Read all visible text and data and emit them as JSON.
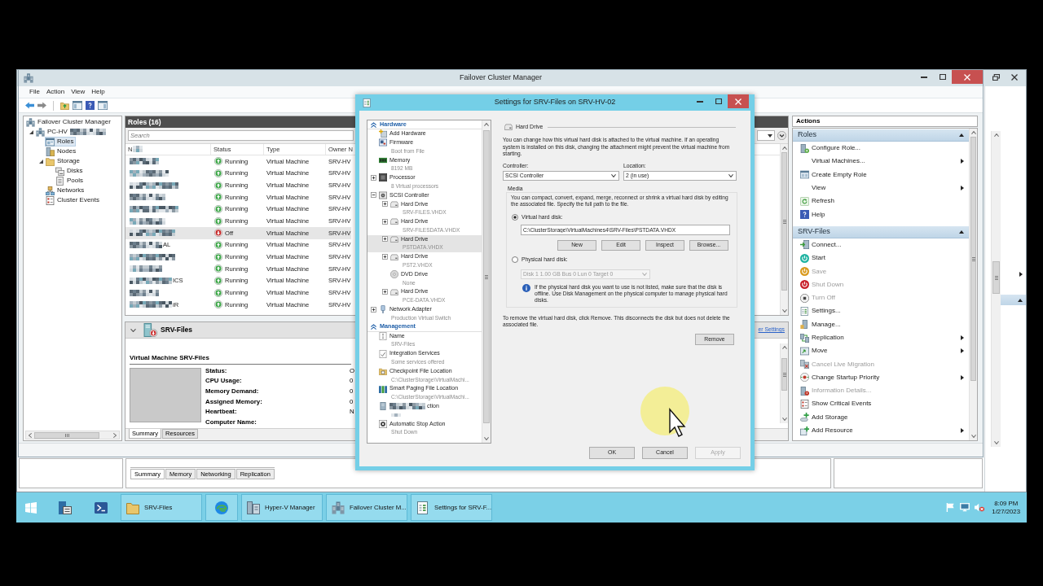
{
  "fcm_window": {
    "title": "Failover Cluster Manager",
    "menu": [
      "File",
      "Action",
      "View",
      "Help"
    ],
    "tree": [
      {
        "label": "Failover Cluster Manager",
        "kind": "cluster-manager",
        "selected": false,
        "children": [
          {
            "label": "PC-HV",
            "kind": "cluster",
            "redacted": true,
            "expanded": true,
            "selected": false,
            "children": [
              {
                "label": "Roles",
                "kind": "roles",
                "selected": true
              },
              {
                "label": "Nodes",
                "kind": "nodes",
                "selected": false
              },
              {
                "label": "Storage",
                "kind": "storage",
                "expanded": true,
                "selected": false,
                "children": [
                  {
                    "label": "Disks",
                    "kind": "disks",
                    "selected": false
                  },
                  {
                    "label": "Pools",
                    "kind": "pools",
                    "selected": false
                  }
                ]
              },
              {
                "label": "Networks",
                "kind": "networks",
                "selected": false
              },
              {
                "label": "Cluster Events",
                "kind": "events",
                "selected": false
              }
            ]
          }
        ]
      }
    ],
    "roles": {
      "title": "Roles (16)",
      "search": {
        "placeholder": "Search"
      },
      "columns": [
        {
          "label": "N",
          "redacted": true
        },
        {
          "label": "Status",
          "redacted": false
        },
        {
          "label": "Type",
          "redacted": false
        },
        {
          "label": "Owner N",
          "redacted": false
        }
      ],
      "rows": [
        {
          "kind": "running",
          "status": "Running",
          "type": "Virtual Machine",
          "owner": "SRV-HV",
          "selected": false
        },
        {
          "kind": "running",
          "status": "Running",
          "type": "Virtual Machine",
          "owner": "SRV-HV",
          "selected": false
        },
        {
          "kind": "running",
          "status": "Running",
          "type": "Virtual Machine",
          "owner": "SRV-HV",
          "selected": false
        },
        {
          "kind": "running",
          "status": "Running",
          "type": "Virtual Machine",
          "owner": "SRV-HV",
          "selected": false
        },
        {
          "kind": "running",
          "status": "Running",
          "type": "Virtual Machine",
          "owner": "SRV-HV",
          "selected": false
        },
        {
          "kind": "running",
          "status": "Running",
          "type": "Virtual Machine",
          "owner": "SRV-HV",
          "selected": false
        },
        {
          "kind": "off",
          "status": "Off",
          "type": "Virtual Machine",
          "owner": "SRV-HV",
          "selected": true
        },
        {
          "name": "AL",
          "kind": "running",
          "status": "Running",
          "type": "Virtual Machine",
          "owner": "SRV-HV",
          "selected": false
        },
        {
          "kind": "running",
          "status": "Running",
          "type": "Virtual Machine",
          "owner": "SRV-HV",
          "selected": false
        },
        {
          "kind": "running",
          "status": "Running",
          "type": "Virtual Machine",
          "owner": "SRV-HV",
          "selected": false
        },
        {
          "name": "ICS",
          "kind": "running",
          "status": "Running",
          "type": "Virtual Machine",
          "owner": "SRV-HV",
          "selected": false
        },
        {
          "kind": "running",
          "status": "Running",
          "type": "Virtual Machine",
          "owner": "SRV-HV",
          "selected": false
        },
        {
          "name": "iR",
          "kind": "running",
          "status": "Running",
          "type": "Virtual Machine",
          "owner": "SRV-HV",
          "selected": false
        }
      ]
    },
    "details": {
      "expanded": true,
      "title": "SRV-Files",
      "link": "er Settings",
      "heading": "Virtual Machine SRV-Files",
      "fields": [
        {
          "label": "Status:",
          "value": "O"
        },
        {
          "label": "CPU Usage:",
          "value": "0"
        },
        {
          "label": "Memory Demand:",
          "value": "0"
        },
        {
          "label": "Assigned Memory:",
          "value": "0"
        },
        {
          "label": "Heartbeat:",
          "value": "N"
        },
        {
          "label": "Computer Name:"
        }
      ],
      "tabs": [
        {
          "label": "Summary",
          "selected": true
        },
        {
          "label": "Resources",
          "selected": false
        }
      ]
    },
    "actions": {
      "title": "Actions",
      "sections": [
        {
          "title": "Roles",
          "expanded": true,
          "items": [
            {
              "label": "Configure Role...",
              "kind": "configure",
              "submenu": false,
              "disabled": false
            },
            {
              "label": "Virtual Machines...",
              "kind": "plain",
              "submenu": true,
              "disabled": false
            },
            {
              "label": "Create Empty Role",
              "kind": "create-role",
              "submenu": false,
              "disabled": false
            },
            {
              "label": "View",
              "kind": "plain",
              "submenu": true,
              "disabled": false
            },
            {
              "label": "Refresh",
              "kind": "refresh",
              "submenu": false,
              "disabled": false
            },
            {
              "label": "Help",
              "kind": "help",
              "submenu": false,
              "disabled": false
            }
          ]
        },
        {
          "title": "SRV-Files",
          "expanded": true,
          "items": [
            {
              "label": "Connect...",
              "kind": "connect",
              "submenu": false,
              "disabled": false
            },
            {
              "label": "Start",
              "kind": "start",
              "submenu": false,
              "disabled": false
            },
            {
              "label": "Save",
              "kind": "save",
              "submenu": false,
              "disabled": true
            },
            {
              "label": "Shut Down",
              "kind": "shutdown",
              "submenu": false,
              "disabled": true
            },
            {
              "label": "Turn Off",
              "kind": "turnoff",
              "submenu": false,
              "disabled": true
            },
            {
              "label": "Settings...",
              "kind": "settings",
              "submenu": false,
              "disabled": false
            },
            {
              "label": "Manage...",
              "kind": "manage",
              "submenu": false,
              "disabled": false
            },
            {
              "label": "Replication",
              "kind": "replication",
              "submenu": true,
              "disabled": false
            },
            {
              "label": "Move",
              "kind": "move",
              "submenu": true,
              "disabled": false
            },
            {
              "label": "Cancel Live Migration",
              "kind": "cancel-migration",
              "submenu": false,
              "disabled": true
            },
            {
              "label": "Change Startup Priority",
              "kind": "priority",
              "submenu": true,
              "disabled": false
            },
            {
              "label": "Information Details...",
              "kind": "info",
              "submenu": false,
              "disabled": true
            },
            {
              "label": "Show Critical Events",
              "kind": "events",
              "submenu": false,
              "disabled": false
            },
            {
              "label": "Add Storage",
              "kind": "add-storage",
              "submenu": false,
              "disabled": false
            },
            {
              "label": "Add Resource",
              "kind": "add-resource",
              "submenu": true,
              "disabled": false
            }
          ]
        }
      ]
    }
  },
  "settings_dialog": {
    "title": "Settings for SRV-Files on SRV-HV-02",
    "tree": [
      {
        "title": "Hardware",
        "expanded": true,
        "items": [
          {
            "label": "Add Hardware",
            "kind": "add-hardware",
            "selected": false
          },
          {
            "label": "Firmware",
            "detail": "Boot from File",
            "kind": "firmware",
            "selected": false
          },
          {
            "label": "Memory",
            "detail": "8192 MB",
            "kind": "memory",
            "selected": false
          },
          {
            "label": "Processor",
            "detail": "8 Virtual processors",
            "kind": "processor",
            "expanded": false,
            "selected": false
          },
          {
            "label": "SCSI Controller",
            "kind": "scsi",
            "expanded": true,
            "selected": false,
            "children": [
              {
                "label": "Hard Drive",
                "detail": "SRV-FILES.VHDX",
                "kind": "disk",
                "expanded": false,
                "selected": false
              },
              {
                "label": "Hard Drive",
                "detail": "SRV-FILESDATA.VHDX",
                "kind": "disk",
                "expanded": false,
                "selected": false
              },
              {
                "label": "Hard Drive",
                "detail": "PSTDATA.VHDX",
                "kind": "disk",
                "expanded": false,
                "selected": true
              },
              {
                "label": "Hard Drive",
                "detail": "PST2.VHDX",
                "kind": "disk",
                "expanded": false,
                "selected": false
              },
              {
                "label": "DVD Drive",
                "detail": "None",
                "kind": "dvd",
                "selected": false
              },
              {
                "label": "Hard Drive",
                "detail": "PCE-DATA.VHDX",
                "kind": "disk",
                "expanded": false,
                "selected": false
              }
            ]
          },
          {
            "label": "Network Adapter",
            "detail": "Production Virtual Switch",
            "kind": "network",
            "expanded": false,
            "selected": false
          }
        ]
      },
      {
        "title": "Management",
        "expanded": true,
        "items": [
          {
            "label": "Name",
            "detail": "SRV-Files",
            "kind": "name",
            "selected": false
          },
          {
            "label": "Integration Services",
            "detail": "Some services offered",
            "kind": "integration",
            "selected": false
          },
          {
            "label": "Checkpoint File Location",
            "detail": "C:\\ClusterStorage\\VirtualMachi...",
            "kind": "checkpoint",
            "selected": false
          },
          {
            "label": "Smart Paging File Location",
            "detail": "C:\\ClusterStorage\\VirtualMachi...",
            "kind": "paging",
            "selected": false
          },
          {
            "label": "ction",
            "kind": "generic",
            "redacted": true,
            "selected": false
          },
          {
            "label": "Automatic Stop Action",
            "detail": "Shut Down",
            "kind": "stop",
            "selected": false
          }
        ]
      }
    ],
    "pane": {
      "heading": "Hard Drive",
      "intro": "You can change how this virtual hard disk is attached to the virtual machine. If an operating system is installed on this disk, changing the attachment might prevent the virtual machine from starting.",
      "controller": {
        "label": "Controller:",
        "value": "SCSI Controller"
      },
      "location": {
        "label": "Location:",
        "value": "2 (in use)"
      },
      "media": {
        "label": "Media",
        "text": "You can compact, convert, expand, merge, reconnect or shrink a virtual hard disk by editing the associated file. Specify the full path to the file.",
        "options": [
          {
            "label": "Virtual hard disk:",
            "selected": true
          },
          {
            "label": "Physical hard disk:",
            "selected": false
          }
        ],
        "path": "C:\\ClusterStorage\\VirtualMachines4\\SRV-Files\\PSTDATA.VHDX",
        "buttons": [
          "New",
          "Edit",
          "Inspect",
          "Browse..."
        ],
        "physical_disk": {
          "value": "Disk 1 1.00 GB Bus 0 Lun 0 Target 0",
          "disabled": true
        },
        "note": "If the physical hard disk you want to use is not listed, make sure that the disk is offline. Use Disk Management on the physical computer to manage physical hard disks."
      },
      "remove_text": "To remove the virtual hard disk, click Remove. This disconnects the disk but does not delete the associated file.",
      "remove_button": "Remove"
    },
    "buttons": [
      {
        "label": "OK",
        "disabled": false
      },
      {
        "label": "Cancel",
        "disabled": false
      },
      {
        "label": "Apply",
        "disabled": true
      }
    ]
  },
  "background_window": {
    "tabs": [
      {
        "label": "Summary",
        "selected": true
      },
      {
        "label": "Memory",
        "selected": false
      },
      {
        "label": "Networking",
        "selected": false
      },
      {
        "label": "Replication",
        "selected": false
      }
    ]
  },
  "taskbar": {
    "items": [
      {
        "kind": "start",
        "open": false
      },
      {
        "kind": "server-manager",
        "open": false
      },
      {
        "kind": "powershell",
        "open": false
      },
      {
        "kind": "folder",
        "label": "SRV-Files",
        "open": true
      },
      {
        "kind": "edge",
        "open": true
      },
      {
        "kind": "hyperv",
        "label": "Hyper-V Manager",
        "open": true
      },
      {
        "kind": "cluster",
        "label": "Failover Cluster M...",
        "open": true
      },
      {
        "kind": "settings",
        "label": "Settings for SRV-F...",
        "open": true
      }
    ],
    "clock": {
      "time": "8:09 PM",
      "date": "1/27/2023"
    }
  }
}
